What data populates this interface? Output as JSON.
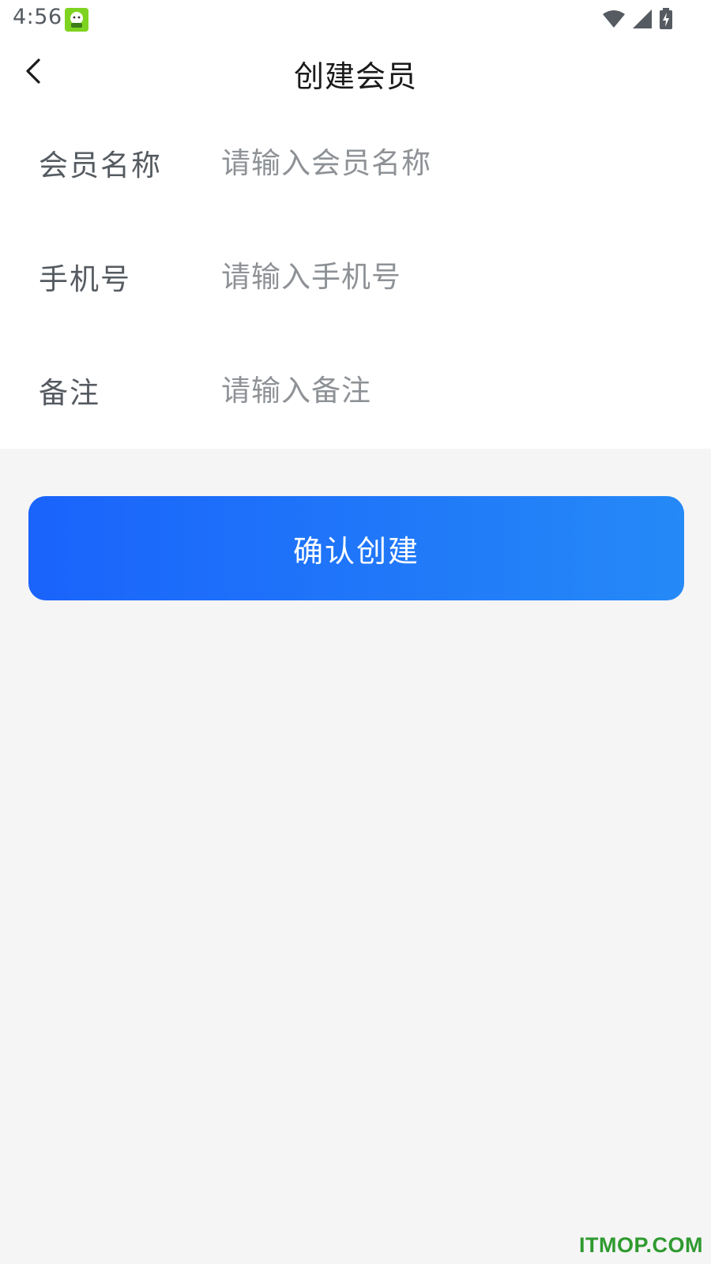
{
  "status_bar": {
    "time": "4:56",
    "icons": [
      "app-notification-icon",
      "wifi-icon",
      "cellular-signal-icon",
      "battery-charging-icon"
    ]
  },
  "nav": {
    "title": "创建会员",
    "back_icon": "chevron-left-icon"
  },
  "form": {
    "fields": [
      {
        "label": "会员名称",
        "placeholder": "请输入会员名称",
        "value": ""
      },
      {
        "label": "手机号",
        "placeholder": "请输入手机号",
        "value": ""
      },
      {
        "label": "备注",
        "placeholder": "请输入备注",
        "value": ""
      }
    ]
  },
  "actions": {
    "confirm_label": "确认创建"
  },
  "watermark": {
    "text": "ITMOP.COM"
  },
  "colors": {
    "button_gradient_start": "#1a63fb",
    "button_gradient_end": "#2589f7",
    "label": "#555b61",
    "placeholder": "#8e9296",
    "background": "#f5f5f6",
    "watermark": "#2f9a2f"
  }
}
